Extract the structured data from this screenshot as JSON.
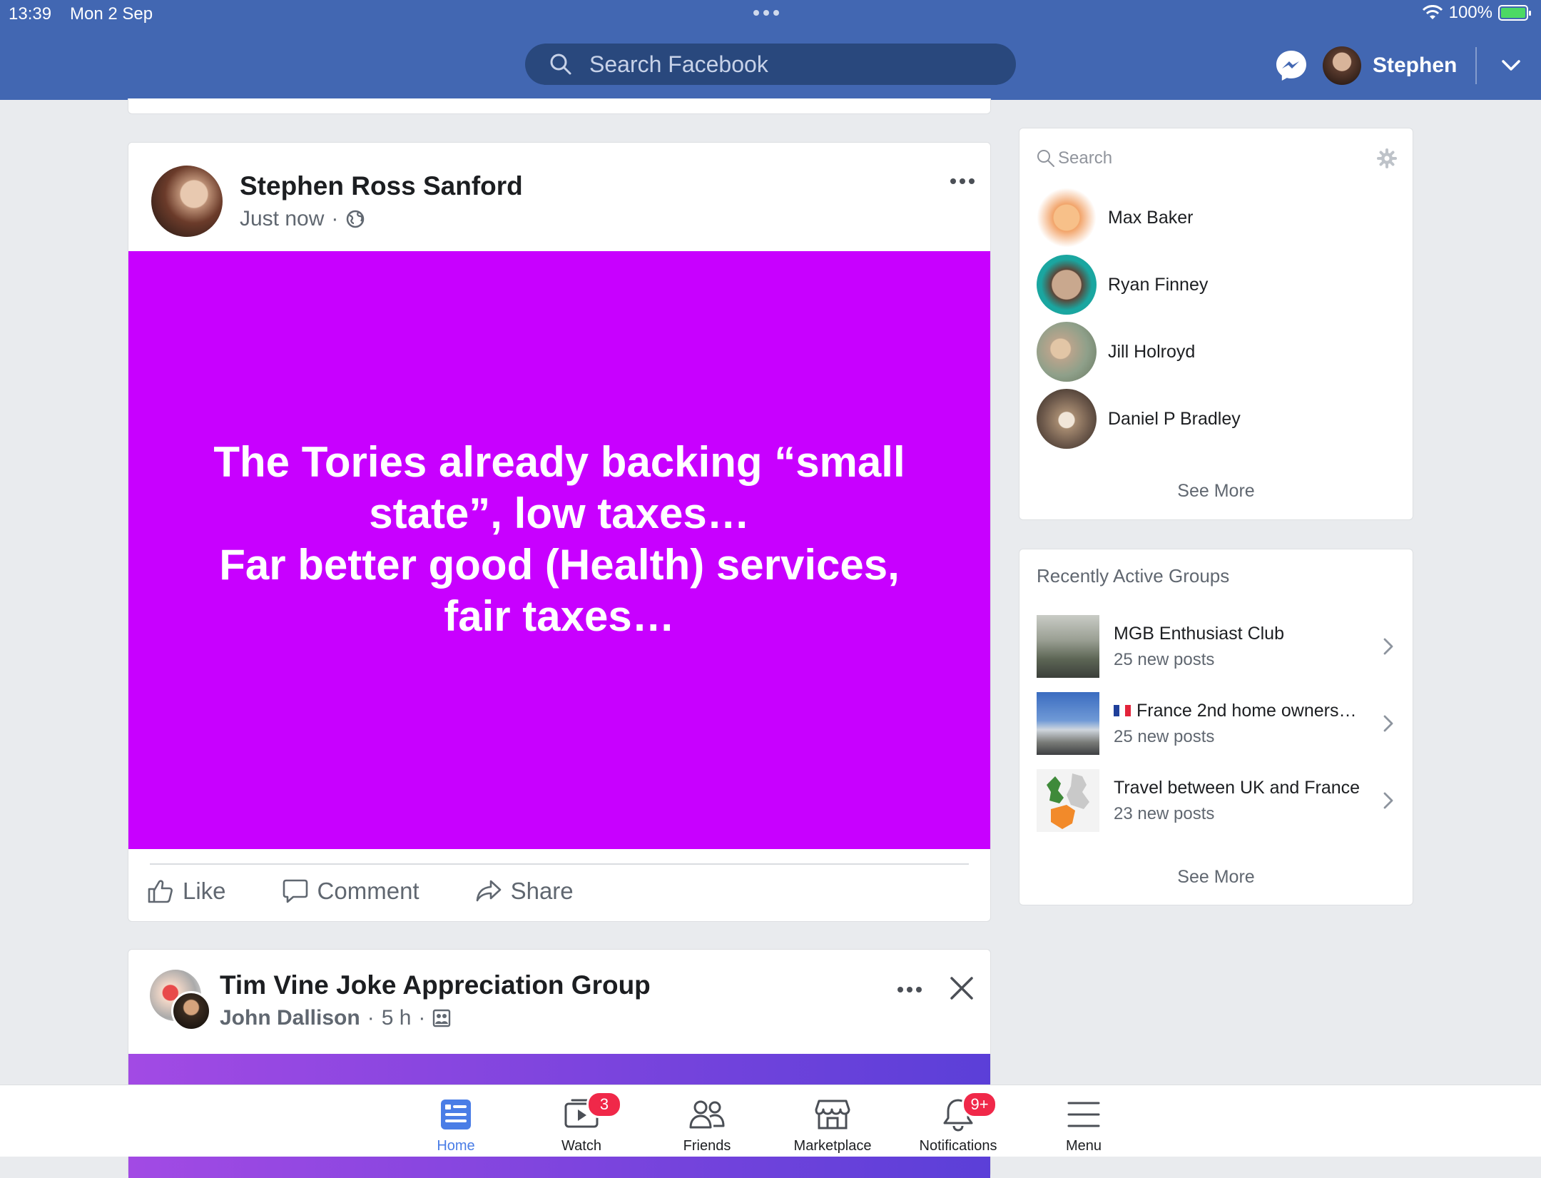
{
  "status_bar": {
    "time": "13:39",
    "date": "Mon 2 Sep",
    "battery": "100%",
    "battery_level": 1.0
  },
  "header": {
    "search_placeholder": "Search Facebook",
    "user_name": "Stephen"
  },
  "feed": {
    "post1": {
      "author": "Stephen Ross Sanford",
      "time": "Just now",
      "separator": "·",
      "background_color": "#c800ff",
      "text": "The Tories already backing “small state”, low taxes…\nFar better good (Health) services, fair taxes…",
      "actions": {
        "like": "Like",
        "comment": "Comment",
        "share": "Share"
      }
    },
    "post2": {
      "group": "Tim Vine Joke Appreciation Group",
      "author": "John Dallison",
      "separator": "·",
      "time": "5 h",
      "separator2": "·"
    }
  },
  "contacts": {
    "search_placeholder": "Search",
    "items": [
      {
        "name": "Max Baker",
        "avatar_color": "#f2a46a"
      },
      {
        "name": "Ryan Finney",
        "avatar_color": "#1aa6a0"
      },
      {
        "name": "Jill Holroyd",
        "avatar_color": "#8fa08a"
      },
      {
        "name": "Daniel P Bradley",
        "avatar_color": "#6e5a4c"
      }
    ],
    "see_more": "See More"
  },
  "groups": {
    "title": "Recently Active Groups",
    "items": [
      {
        "name": "MGB Enthusiast Club",
        "posts": "25 new posts"
      },
      {
        "name": "France 2nd home owners…",
        "posts": "25 new posts",
        "flag": "france"
      },
      {
        "name": "Travel between UK and France",
        "posts": "23 new posts"
      }
    ],
    "see_more": "See More"
  },
  "tabbar": {
    "items": [
      {
        "label": "Home",
        "active": true
      },
      {
        "label": "Watch",
        "badge": "3"
      },
      {
        "label": "Friends"
      },
      {
        "label": "Marketplace"
      },
      {
        "label": "Notifications",
        "badge": "9+"
      },
      {
        "label": "Menu"
      }
    ]
  },
  "colors": {
    "brand_blue": "#4267b2",
    "search_dark": "#29487d",
    "post_bg": "#c800ff",
    "badge_red": "#f02849"
  }
}
